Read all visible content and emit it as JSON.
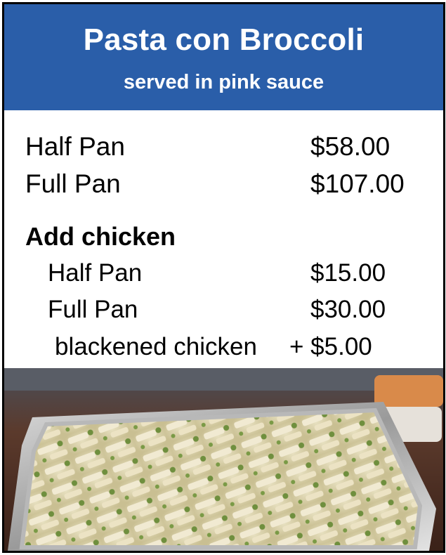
{
  "menu": {
    "title": "Pasta con Broccoli",
    "subtitle": "served in pink sauce",
    "sizes": [
      {
        "label": "Half Pan",
        "price": "$58.00"
      },
      {
        "label": "Full Pan",
        "price": "$107.00"
      }
    ],
    "addon": {
      "heading": "Add chicken",
      "sizes": [
        {
          "label": "Half Pan",
          "price": "$15.00"
        },
        {
          "label": "Full Pan",
          "price": "$30.00"
        }
      ],
      "extra": {
        "label": "blackened chicken",
        "price": "+ $5.00"
      }
    }
  },
  "colors": {
    "header_bg": "#2a5ea9"
  }
}
